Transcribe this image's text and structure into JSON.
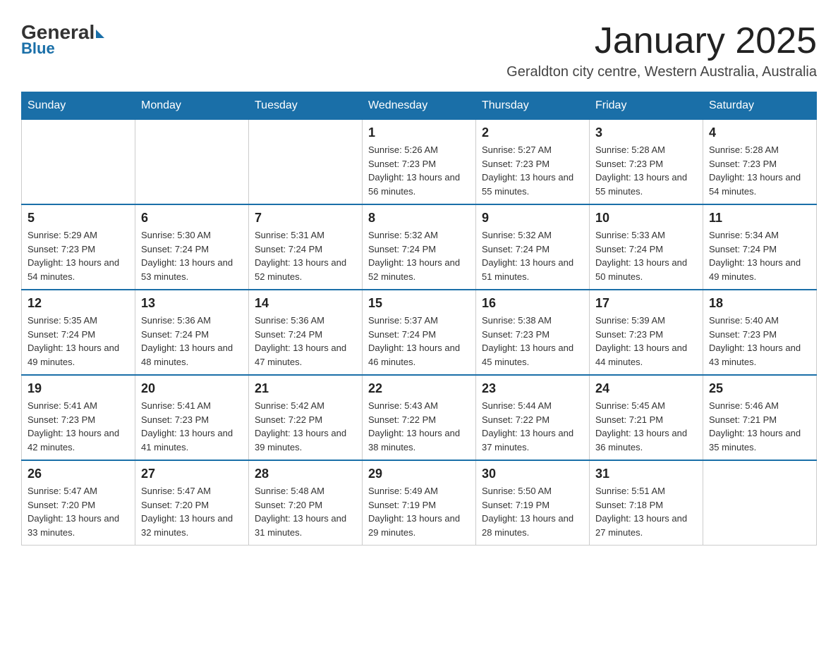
{
  "header": {
    "logo": {
      "general": "General",
      "blue": "Blue"
    },
    "title": "January 2025",
    "location": "Geraldton city centre, Western Australia, Australia"
  },
  "weekdays": [
    "Sunday",
    "Monday",
    "Tuesday",
    "Wednesday",
    "Thursday",
    "Friday",
    "Saturday"
  ],
  "weeks": [
    [
      {
        "day": "",
        "info": ""
      },
      {
        "day": "",
        "info": ""
      },
      {
        "day": "",
        "info": ""
      },
      {
        "day": "1",
        "info": "Sunrise: 5:26 AM\nSunset: 7:23 PM\nDaylight: 13 hours\nand 56 minutes."
      },
      {
        "day": "2",
        "info": "Sunrise: 5:27 AM\nSunset: 7:23 PM\nDaylight: 13 hours\nand 55 minutes."
      },
      {
        "day": "3",
        "info": "Sunrise: 5:28 AM\nSunset: 7:23 PM\nDaylight: 13 hours\nand 55 minutes."
      },
      {
        "day": "4",
        "info": "Sunrise: 5:28 AM\nSunset: 7:23 PM\nDaylight: 13 hours\nand 54 minutes."
      }
    ],
    [
      {
        "day": "5",
        "info": "Sunrise: 5:29 AM\nSunset: 7:23 PM\nDaylight: 13 hours\nand 54 minutes."
      },
      {
        "day": "6",
        "info": "Sunrise: 5:30 AM\nSunset: 7:24 PM\nDaylight: 13 hours\nand 53 minutes."
      },
      {
        "day": "7",
        "info": "Sunrise: 5:31 AM\nSunset: 7:24 PM\nDaylight: 13 hours\nand 52 minutes."
      },
      {
        "day": "8",
        "info": "Sunrise: 5:32 AM\nSunset: 7:24 PM\nDaylight: 13 hours\nand 52 minutes."
      },
      {
        "day": "9",
        "info": "Sunrise: 5:32 AM\nSunset: 7:24 PM\nDaylight: 13 hours\nand 51 minutes."
      },
      {
        "day": "10",
        "info": "Sunrise: 5:33 AM\nSunset: 7:24 PM\nDaylight: 13 hours\nand 50 minutes."
      },
      {
        "day": "11",
        "info": "Sunrise: 5:34 AM\nSunset: 7:24 PM\nDaylight: 13 hours\nand 49 minutes."
      }
    ],
    [
      {
        "day": "12",
        "info": "Sunrise: 5:35 AM\nSunset: 7:24 PM\nDaylight: 13 hours\nand 49 minutes."
      },
      {
        "day": "13",
        "info": "Sunrise: 5:36 AM\nSunset: 7:24 PM\nDaylight: 13 hours\nand 48 minutes."
      },
      {
        "day": "14",
        "info": "Sunrise: 5:36 AM\nSunset: 7:24 PM\nDaylight: 13 hours\nand 47 minutes."
      },
      {
        "day": "15",
        "info": "Sunrise: 5:37 AM\nSunset: 7:24 PM\nDaylight: 13 hours\nand 46 minutes."
      },
      {
        "day": "16",
        "info": "Sunrise: 5:38 AM\nSunset: 7:23 PM\nDaylight: 13 hours\nand 45 minutes."
      },
      {
        "day": "17",
        "info": "Sunrise: 5:39 AM\nSunset: 7:23 PM\nDaylight: 13 hours\nand 44 minutes."
      },
      {
        "day": "18",
        "info": "Sunrise: 5:40 AM\nSunset: 7:23 PM\nDaylight: 13 hours\nand 43 minutes."
      }
    ],
    [
      {
        "day": "19",
        "info": "Sunrise: 5:41 AM\nSunset: 7:23 PM\nDaylight: 13 hours\nand 42 minutes."
      },
      {
        "day": "20",
        "info": "Sunrise: 5:41 AM\nSunset: 7:23 PM\nDaylight: 13 hours\nand 41 minutes."
      },
      {
        "day": "21",
        "info": "Sunrise: 5:42 AM\nSunset: 7:22 PM\nDaylight: 13 hours\nand 39 minutes."
      },
      {
        "day": "22",
        "info": "Sunrise: 5:43 AM\nSunset: 7:22 PM\nDaylight: 13 hours\nand 38 minutes."
      },
      {
        "day": "23",
        "info": "Sunrise: 5:44 AM\nSunset: 7:22 PM\nDaylight: 13 hours\nand 37 minutes."
      },
      {
        "day": "24",
        "info": "Sunrise: 5:45 AM\nSunset: 7:21 PM\nDaylight: 13 hours\nand 36 minutes."
      },
      {
        "day": "25",
        "info": "Sunrise: 5:46 AM\nSunset: 7:21 PM\nDaylight: 13 hours\nand 35 minutes."
      }
    ],
    [
      {
        "day": "26",
        "info": "Sunrise: 5:47 AM\nSunset: 7:20 PM\nDaylight: 13 hours\nand 33 minutes."
      },
      {
        "day": "27",
        "info": "Sunrise: 5:47 AM\nSunset: 7:20 PM\nDaylight: 13 hours\nand 32 minutes."
      },
      {
        "day": "28",
        "info": "Sunrise: 5:48 AM\nSunset: 7:20 PM\nDaylight: 13 hours\nand 31 minutes."
      },
      {
        "day": "29",
        "info": "Sunrise: 5:49 AM\nSunset: 7:19 PM\nDaylight: 13 hours\nand 29 minutes."
      },
      {
        "day": "30",
        "info": "Sunrise: 5:50 AM\nSunset: 7:19 PM\nDaylight: 13 hours\nand 28 minutes."
      },
      {
        "day": "31",
        "info": "Sunrise: 5:51 AM\nSunset: 7:18 PM\nDaylight: 13 hours\nand 27 minutes."
      },
      {
        "day": "",
        "info": ""
      }
    ]
  ]
}
